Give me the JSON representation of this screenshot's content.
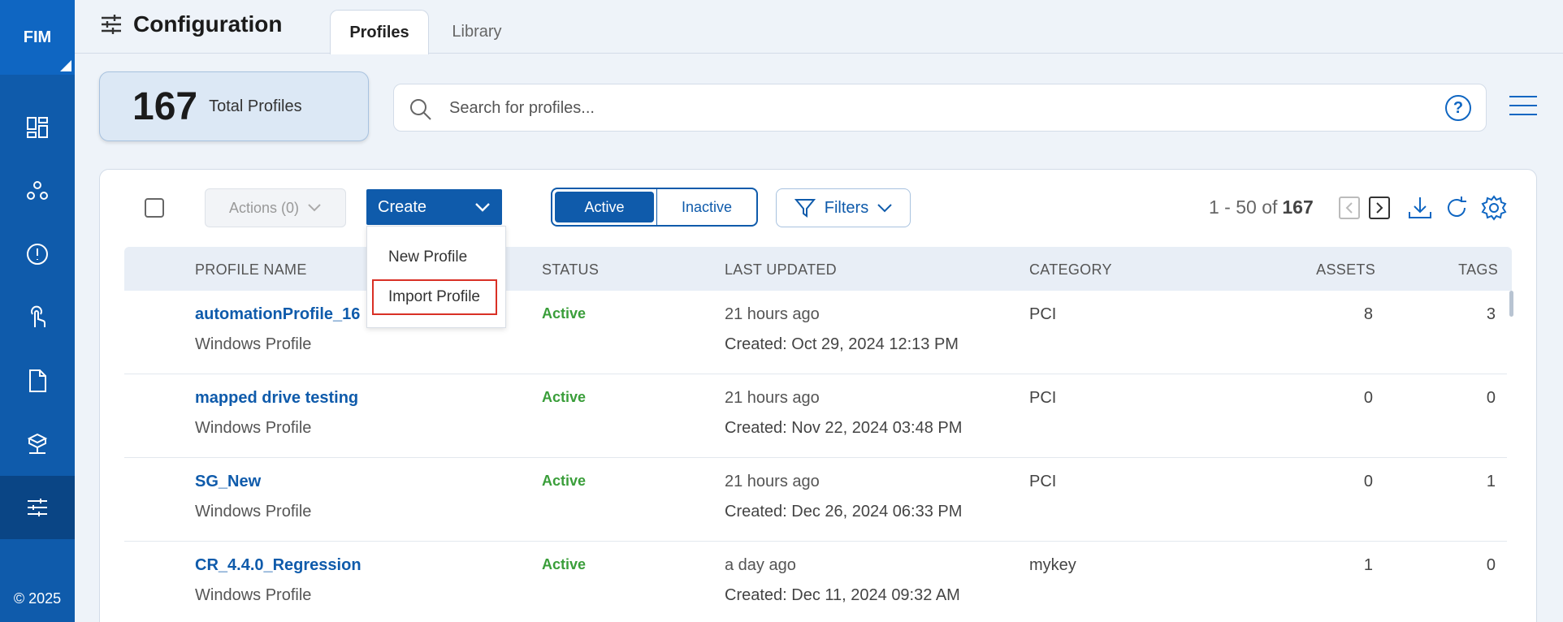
{
  "nav": {
    "brand": "FIM",
    "copyright": "© 2025",
    "items": [
      {
        "icon": "dashboard-icon"
      },
      {
        "icon": "hub-icon"
      },
      {
        "icon": "alert-icon"
      },
      {
        "icon": "touch-icon"
      },
      {
        "icon": "document-icon"
      },
      {
        "icon": "network-icon"
      },
      {
        "icon": "sliders-icon",
        "active": true
      }
    ]
  },
  "header": {
    "title": "Configuration",
    "tabs": [
      {
        "label": "Profiles",
        "active": true
      },
      {
        "label": "Library",
        "active": false
      }
    ]
  },
  "summary": {
    "count": "167",
    "label": "Total Profiles"
  },
  "search": {
    "placeholder": "Search for profiles...",
    "help": "?"
  },
  "toolbar": {
    "actions_label": "Actions (0)",
    "create_label": "Create",
    "create_menu": [
      "New Profile",
      "Import Profile"
    ],
    "status_toggle": [
      "Active",
      "Inactive"
    ],
    "filters_label": "Filters",
    "pagination": {
      "range": "1 - 50 of",
      "total": "167"
    }
  },
  "table": {
    "columns": [
      "PROFILE NAME",
      "STATUS",
      "LAST UPDATED",
      "CATEGORY",
      "ASSETS",
      "TAGS"
    ],
    "rows": [
      {
        "name": "automationProfile_16",
        "type": "Windows Profile",
        "status": "Active",
        "updated": "21 hours ago",
        "created": "Created: Oct 29, 2024 12:13 PM",
        "category": "PCI",
        "assets": "8",
        "tags": "3"
      },
      {
        "name": "mapped drive testing",
        "type": "Windows Profile",
        "status": "Active",
        "updated": "21 hours ago",
        "created": "Created: Nov 22, 2024 03:48 PM",
        "category": "PCI",
        "assets": "0",
        "tags": "0"
      },
      {
        "name": "SG_New",
        "type": "Windows Profile",
        "status": "Active",
        "updated": "21 hours ago",
        "created": "Created: Dec 26, 2024 06:33 PM",
        "category": "PCI",
        "assets": "0",
        "tags": "1"
      },
      {
        "name": "CR_4.4.0_Regression",
        "type": "Windows Profile",
        "status": "Active",
        "updated": "a day ago",
        "created": "Created: Dec 11, 2024 09:32 AM",
        "category": "mykey",
        "assets": "1",
        "tags": "0"
      }
    ]
  },
  "colors": {
    "primary": "#0f5bab",
    "nav_bg": "#0f5bab",
    "status_active": "#3a9e3a",
    "highlight": "#d93025"
  }
}
